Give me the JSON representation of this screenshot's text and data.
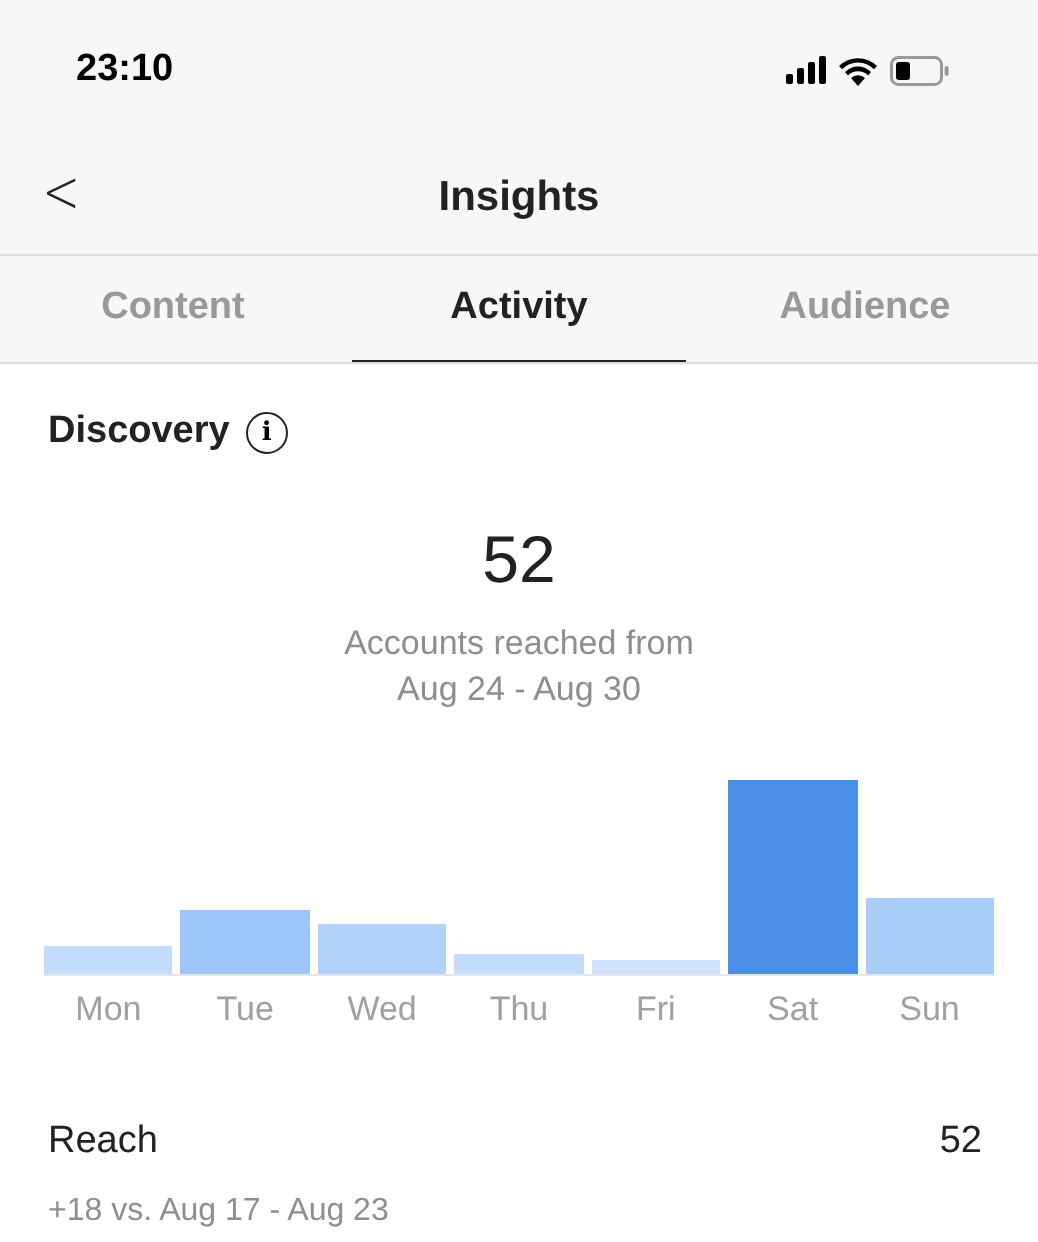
{
  "status_bar": {
    "time": "23:10"
  },
  "header": {
    "back": "<",
    "title": "Insights"
  },
  "tabs": [
    {
      "label": "Content",
      "selected": false
    },
    {
      "label": "Activity",
      "selected": true
    },
    {
      "label": "Audience",
      "selected": false
    }
  ],
  "discovery": {
    "title": "Discovery",
    "info": "i",
    "value": "52",
    "caption_line_1": "Accounts reached from",
    "caption_line_2": "Aug 24 - Aug 30",
    "days": [
      {
        "label": "Mon",
        "selected": false
      },
      {
        "label": "Tue",
        "selected": false
      },
      {
        "label": "Wed",
        "selected": false
      },
      {
        "label": "Thu",
        "selected": false
      },
      {
        "label": "Fri",
        "selected": false
      },
      {
        "label": "Sat",
        "selected": true
      },
      {
        "label": "Sun",
        "selected": false
      }
    ]
  },
  "reach": {
    "label": "Reach",
    "value": "52",
    "comparison": "+18 vs. Aug 17 - Aug 23"
  }
}
